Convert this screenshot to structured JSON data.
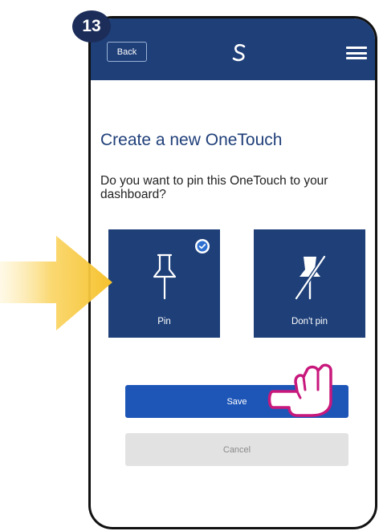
{
  "step": {
    "number": "13"
  },
  "topbar": {
    "back_label": "Back",
    "logo_icon": "salus-swirl-icon",
    "menu_icon": "hamburger-menu-icon"
  },
  "screen": {
    "title": "Create a new OneTouch",
    "question": "Do you want to pin this OneTouch to your dashboard?"
  },
  "options": [
    {
      "label": "Pin",
      "icon": "pushpin-icon",
      "selected": true
    },
    {
      "label": "Don't pin",
      "icon": "pushpin-crossed-icon",
      "selected": false
    }
  ],
  "buttons": {
    "save": "Save",
    "cancel": "Cancel"
  },
  "colors": {
    "navy": "#1f3f79",
    "tile": "#1e3f78",
    "save": "#1e56b8",
    "cancel": "#e2e2e2",
    "pointer": "#c8187c",
    "arrow": "#f7c63a"
  }
}
